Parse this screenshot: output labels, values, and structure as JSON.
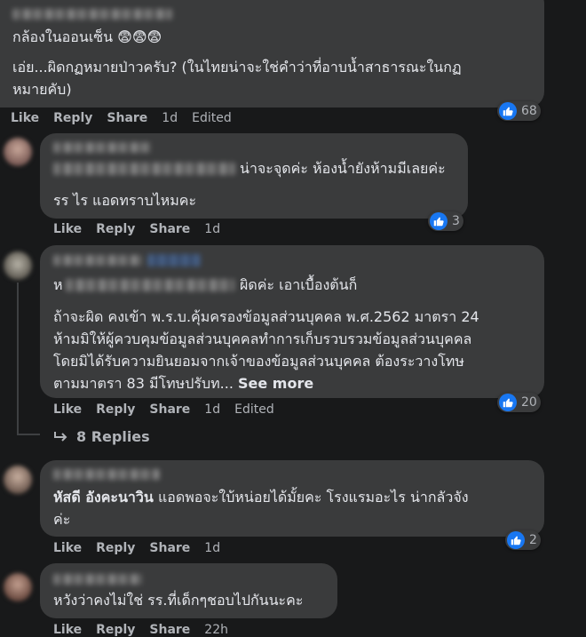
{
  "colors": {
    "background": "#18191a",
    "bubble": "#3a3b3c",
    "text": "#e4e6eb",
    "secondary": "#b0b3b8",
    "like_blue": "#1877f2"
  },
  "comments": [
    {
      "lines": [
        "กล้องในออนเซ็น 😨😨😨",
        "เอ่ย...ผิดกฏหมายป่าวครับ? (ในไทยน่าจะใช่คำว่าที่อาบน้ำสาธารณะในกฏ",
        "หมายคับ)"
      ],
      "actions": {
        "like": "Like",
        "reply": "Reply",
        "share": "Share",
        "time": "1d",
        "edited": "Edited"
      },
      "reaction_count": "68"
    },
    {
      "lines": [
        "น่าจะจุดค่ะ ห้องน้ำยังห้ามมีเลยค่ะ",
        "รร ไร แอดทราบไหมคะ"
      ],
      "actions": {
        "like": "Like",
        "reply": "Reply",
        "share": "Share",
        "time": "1d"
      },
      "reaction_count": "3"
    },
    {
      "lines": [
        "ผิดค่ะ เอาเบื้องต้นก็",
        "ถ้าจะผิด คงเข้า พ.ร.บ.คุ้มครองข้อมูลส่วนบุคคล พ.ศ.2562 มาตรา 24",
        "ห้ามมิให้ผู้ควบคุมข้อมูลส่วนบุคคลทำการเก็บรวบรวมข้อมูลส่วนบุคคล",
        "โดยมิได้รับความยินยอมจากเจ้าของข้อมูลส่วนบุคคล ต้องระวางโทษ",
        "ตามมาตรา 83 มีโทษปรับท..."
      ],
      "see_more": "See more",
      "actions": {
        "like": "Like",
        "reply": "Reply",
        "share": "Share",
        "time": "1d",
        "edited": "Edited"
      },
      "reaction_count": "20",
      "replies_label": "8 Replies"
    },
    {
      "author_partial": "หัสดี อังคะนาวิน",
      "lines": [
        "แอดพอจะใบ้หน่อยได้มั้ยคะ โรงแรมอะไร น่ากลัวจัง",
        "ค่ะ"
      ],
      "actions": {
        "like": "Like",
        "reply": "Reply",
        "share": "Share",
        "time": "1d"
      },
      "reaction_count": "2"
    },
    {
      "lines": [
        "หวังว่าคงไม่ใช่ รร.ที่เด็กๆชอบไปกันนะคะ"
      ],
      "actions": {
        "like": "Like",
        "reply": "Reply",
        "share": "Share",
        "time": "22h"
      }
    }
  ]
}
